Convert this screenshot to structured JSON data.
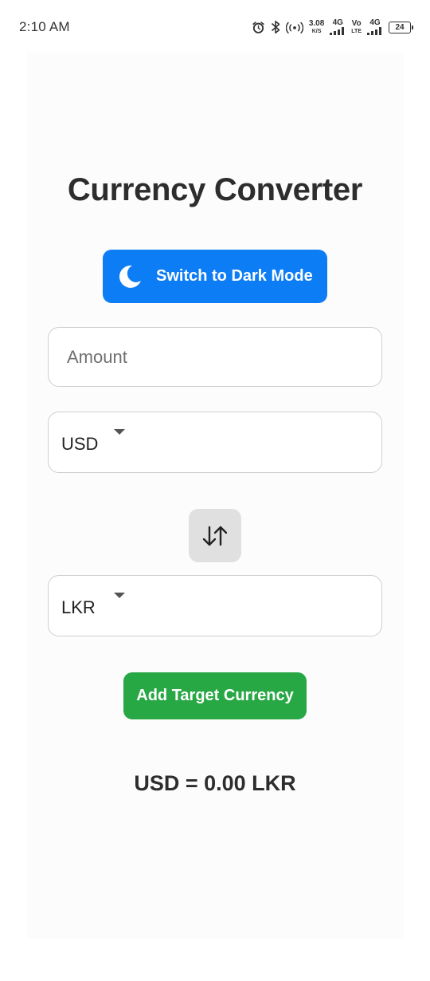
{
  "status_bar": {
    "time": "2:10 AM",
    "network_speed_value": "3.08",
    "network_speed_unit": "K/S",
    "network_1_label": "4G",
    "volte_top": "Vo",
    "volte_bottom": "LTE",
    "network_2_label": "4G",
    "battery_level": "24",
    "icons": [
      "alarm-icon",
      "bluetooth-icon",
      "hotspot-icon",
      "signal-icon",
      "signal-icon",
      "battery-icon"
    ]
  },
  "app": {
    "title": "Currency Converter",
    "dark_mode_button": {
      "label": "Switch to Dark Mode",
      "icon": "moon-icon",
      "color": "#0d7df6"
    },
    "amount_input": {
      "placeholder": "Amount",
      "value": ""
    },
    "from_currency": {
      "selected": "USD"
    },
    "swap_button": {
      "icon": "swap-arrows-icon",
      "color": "#e0e0e0"
    },
    "to_currency": {
      "selected": "LKR"
    },
    "add_target_button": {
      "label": "Add Target Currency",
      "color": "#28a745"
    },
    "result_text": "USD = 0.00 LKR"
  }
}
